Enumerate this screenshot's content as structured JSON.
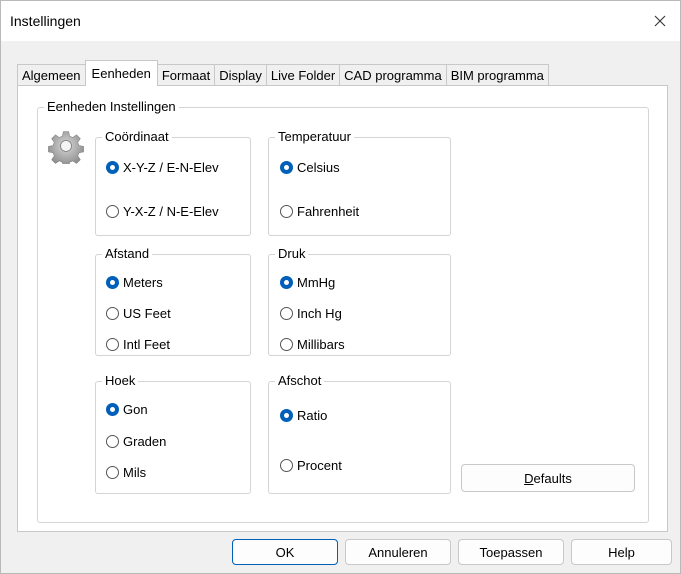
{
  "window": {
    "title": "Instellingen"
  },
  "tabs": [
    "Algemeen",
    "Eenheden",
    "Formaat",
    "Display",
    "Live Folder",
    "CAD programma",
    "BIM programma"
  ],
  "active_tab": "Eenheden",
  "panel": {
    "group_title": "Eenheden Instellingen",
    "coordinaat": {
      "title": "Coördinaat",
      "options": [
        "X-Y-Z / E-N-Elev",
        "Y-X-Z / N-E-Elev"
      ],
      "selected": "X-Y-Z / E-N-Elev"
    },
    "temperatuur": {
      "title": "Temperatuur",
      "options": [
        "Celsius",
        "Fahrenheit"
      ],
      "selected": "Celsius"
    },
    "afstand": {
      "title": "Afstand",
      "options": [
        "Meters",
        "US Feet",
        "Intl Feet"
      ],
      "selected": "Meters"
    },
    "druk": {
      "title": "Druk",
      "options": [
        "MmHg",
        "Inch Hg",
        "Millibars"
      ],
      "selected": "MmHg"
    },
    "hoek": {
      "title": "Hoek",
      "options": [
        "Gon",
        "Graden",
        "Mils"
      ],
      "selected": "Gon"
    },
    "afschot": {
      "title": "Afschot",
      "options": [
        "Ratio",
        "Procent"
      ],
      "selected": "Ratio"
    },
    "defaults_button": {
      "accel": "D",
      "rest": "efaults"
    }
  },
  "buttons": {
    "ok": "OK",
    "cancel": "Annuleren",
    "apply": "Toepassen",
    "help": "Help"
  },
  "icons": {
    "settings": "gear-icon",
    "close": "close-icon"
  },
  "colors": {
    "accent": "#005fb8"
  }
}
